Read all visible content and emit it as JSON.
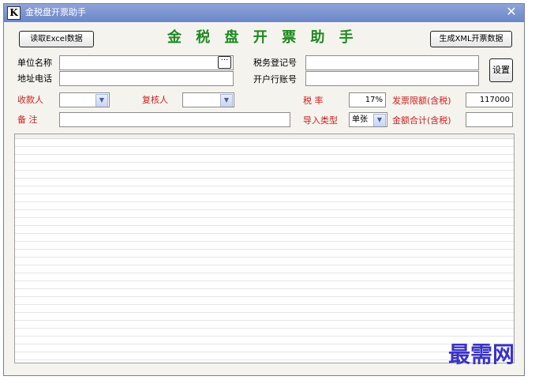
{
  "window": {
    "icon_letter": "K",
    "title": "金税盘开票助手",
    "close_glyph": "✕"
  },
  "toolbar": {
    "read_excel_label": "读取Excel数据",
    "heading": "金 税 盘 开 票 助 手",
    "generate_xml_label": "生成XML开票数据",
    "settings_label": "设置"
  },
  "form": {
    "company_name": {
      "label": "单位名称",
      "value": ""
    },
    "ellipsis_glyph": "···",
    "address_phone": {
      "label": "地址电话",
      "value": ""
    },
    "tax_reg_no": {
      "label": "税务登记号",
      "value": ""
    },
    "bank_account": {
      "label": "开户行账号",
      "value": ""
    },
    "payee": {
      "label": "收款人",
      "value": ""
    },
    "reviewer": {
      "label": "复核人",
      "value": ""
    },
    "remark": {
      "label": "备  注",
      "value": ""
    },
    "tax_rate": {
      "label": "税    率",
      "value": "17%"
    },
    "invoice_limit": {
      "label": "发票限额(含税)",
      "value": "117000"
    },
    "import_type": {
      "label": "导入类型",
      "value": "单张"
    },
    "total_amount": {
      "label": "金额合计(含税)",
      "value": ""
    },
    "dropdown_glyph": "▼"
  },
  "watermark": "最需网",
  "colors": {
    "titlebar": "#7a93d1",
    "heading": "#1e8a1e",
    "label_red": "#cc1f1f",
    "watermark": "#3a33c4"
  }
}
